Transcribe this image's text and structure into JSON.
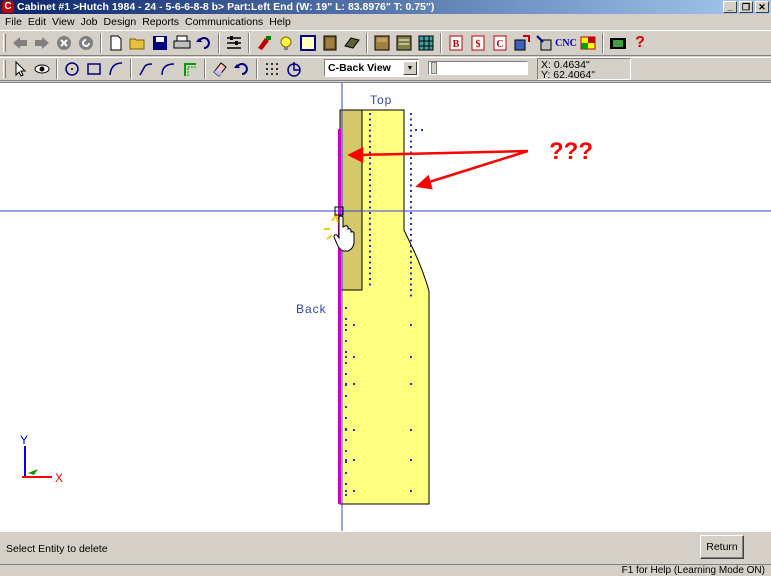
{
  "window": {
    "title": "Cabinet #1 >Hutch 1984 - 24 - 5-6-6-8-8 b> Part:Left End (W: 19\" L: 83.8976\" T: 0.75\")",
    "app_icon_letter": "C",
    "controls": [
      "_",
      "❐",
      "✕"
    ]
  },
  "menu": {
    "items": [
      "File",
      "Edit",
      "View",
      "Job",
      "Design",
      "Reports",
      "Communications",
      "Help"
    ]
  },
  "toolbar": {
    "cnc_label": "CNC",
    "b_label": "B",
    "dollar_label": "$",
    "c_label": "C",
    "help_label": "?"
  },
  "view_selector": {
    "value": "C-Back View"
  },
  "coords": {
    "x": "X:  0.4634\"",
    "y": "Y:  62.4064\""
  },
  "canvas": {
    "top_label": "Top",
    "back_label": "Back",
    "annotation": "???",
    "axis_y": "Y",
    "axis_x": "X",
    "colors": {
      "part_fill": "#ffff80",
      "back_panel": "#cc00cc",
      "inner_panel": "#d4c86a",
      "annotation_red": "#ff0000",
      "crosshair": "#3344cc",
      "holes": "#2233cc"
    }
  },
  "status": {
    "message": "Select Entity to delete",
    "return_label": "Return",
    "help_hint": "F1 for Help (Learning Mode ON)"
  }
}
